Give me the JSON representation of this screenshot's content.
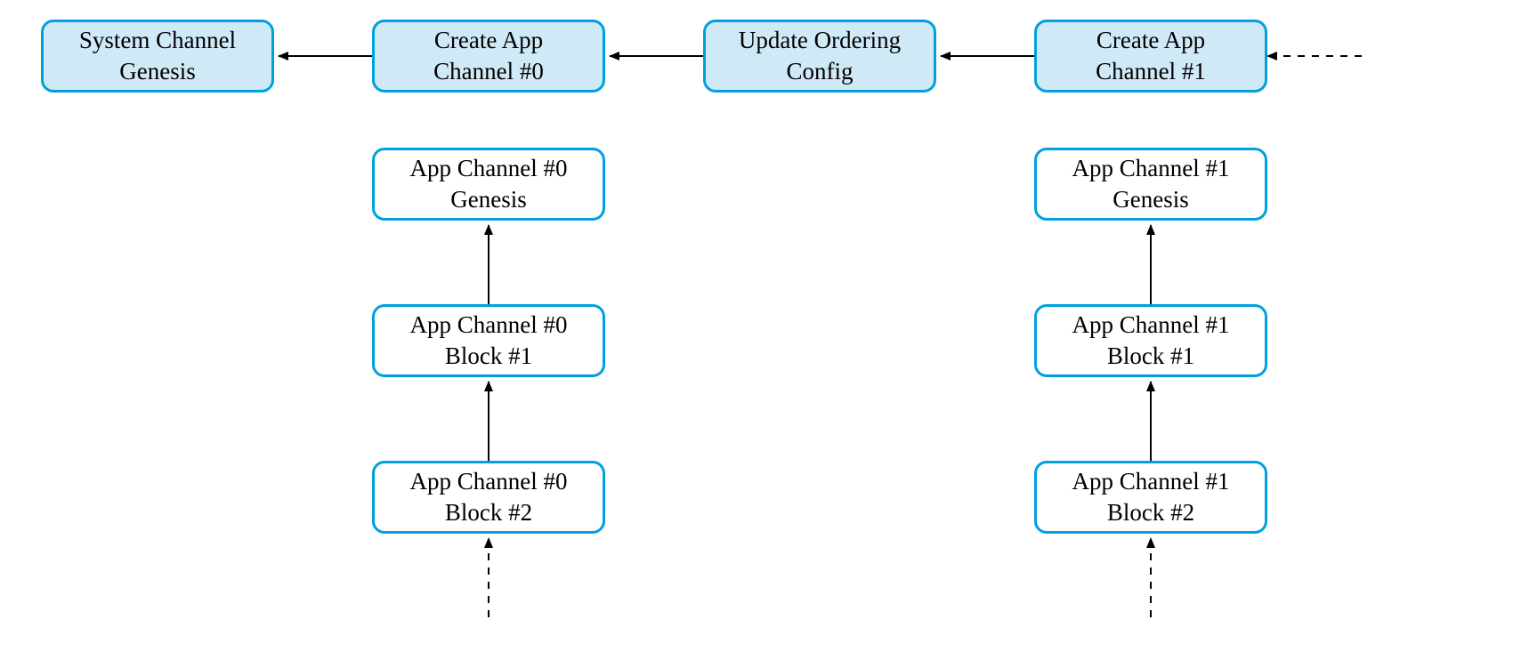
{
  "colors": {
    "border": "#00A0E0",
    "fill": "#d0e9f7",
    "text": "#000000",
    "arrow": "#000000"
  },
  "topRow": {
    "systemChannel": {
      "line1": "System Channel",
      "line2": "Genesis"
    },
    "createApp0": {
      "line1": "Create App",
      "line2": "Channel #0"
    },
    "updateOrdering": {
      "line1": "Update Ordering",
      "line2": "Config"
    },
    "createApp1": {
      "line1": "Create App",
      "line2": "Channel #1"
    }
  },
  "channel0": {
    "genesis": {
      "line1": "App Channel #0",
      "line2": "Genesis"
    },
    "block1": {
      "line1": "App Channel #0",
      "line2": "Block #1"
    },
    "block2": {
      "line1": "App Channel #0",
      "line2": "Block #2"
    }
  },
  "channel1": {
    "genesis": {
      "line1": "App Channel #1",
      "line2": "Genesis"
    },
    "block1": {
      "line1": "App Channel #1",
      "line2": "Block #1"
    },
    "block2": {
      "line1": "App Channel #1",
      "line2": "Block #2"
    }
  }
}
